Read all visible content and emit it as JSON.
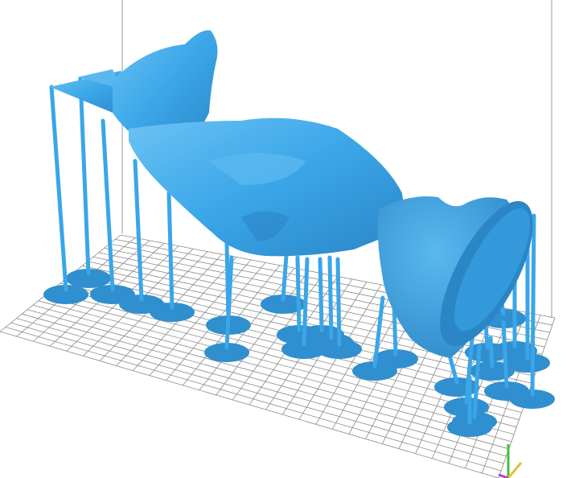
{
  "viewport": {
    "background_color": "#ffffff",
    "build_plate": {
      "grid_color": "#8a8a8a",
      "frame_color": "#9a9a9a"
    },
    "model": {
      "subject": "anubis-bust",
      "color": "#3aa6e8",
      "shade_color": "#2b86c6",
      "highlight_color": "#6cc2f4",
      "support_count": 26,
      "raft_color": "#2f8fcf"
    },
    "axis_gizmo": {
      "x_color": "#e0c040",
      "y_color": "#40c040",
      "z_color": "#c040c0"
    }
  }
}
